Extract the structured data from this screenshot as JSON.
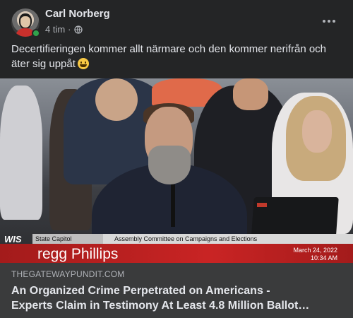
{
  "post": {
    "author": "Carl Norberg",
    "time": "4 tim",
    "separator": "·",
    "text": "Decertifieringen kommer allt närmare och den kommer nerifrån och äter sig uppåt"
  },
  "icons": {
    "privacy": "globe-icon",
    "more": "more-options-icon",
    "emoji": "grinning-face-emoji-icon"
  },
  "video": {
    "network": "WIS",
    "location": "State Capitol",
    "committee": "Assembly Committee on Campaigns and Elections",
    "speaker": "regg Phillips",
    "date": "March 24, 2022",
    "time": "10:34 AM"
  },
  "link": {
    "domain": "THEGATEWAYPUNDIT.COM",
    "headline_line1": "An Organized Crime Perpetrated on Americans -",
    "headline_line2": "Experts Claim in Testimony At Least 4.8 Million Ballot…"
  },
  "colors": {
    "background": "#242526",
    "link_box": "#3a3b3c",
    "online": "#31a24c",
    "banner_red": "#c92424"
  }
}
